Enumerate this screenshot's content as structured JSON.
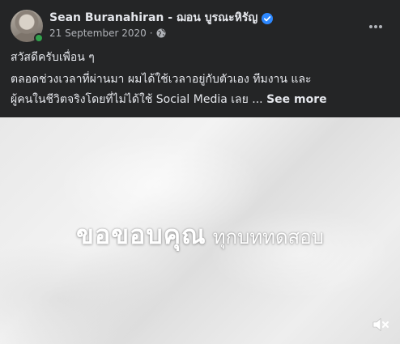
{
  "post": {
    "author": "Sean Buranahiran - ฌอน บูรณะหิรัญ",
    "date": "21 September 2020",
    "separator": "·",
    "text_line1": "สวัสดีครับเพื่อน ๆ",
    "text_line2": "ตลอดช่วงเวลาที่ผ่านมา ผมได้ใช้เวลาอยู่กับตัวเอง ทีมงาน และ",
    "text_line3": "ผู้คนในชีวิตจริงโดยที่ไม่ได้ใช้ Social Media เลย ...",
    "see_more": "See more"
  },
  "video": {
    "overlay_big": "ขอขอบคุณ",
    "overlay_small": "ทุกบททดสอบ"
  },
  "icons": {
    "verified": "verified-badge-icon",
    "globe": "globe-icon",
    "more": "more-options-icon",
    "mute": "volume-muted-icon"
  },
  "colors": {
    "background": "#242526",
    "verified": "#2d88ff",
    "online": "#31a24c",
    "secondary_text": "#b0b3b8"
  }
}
